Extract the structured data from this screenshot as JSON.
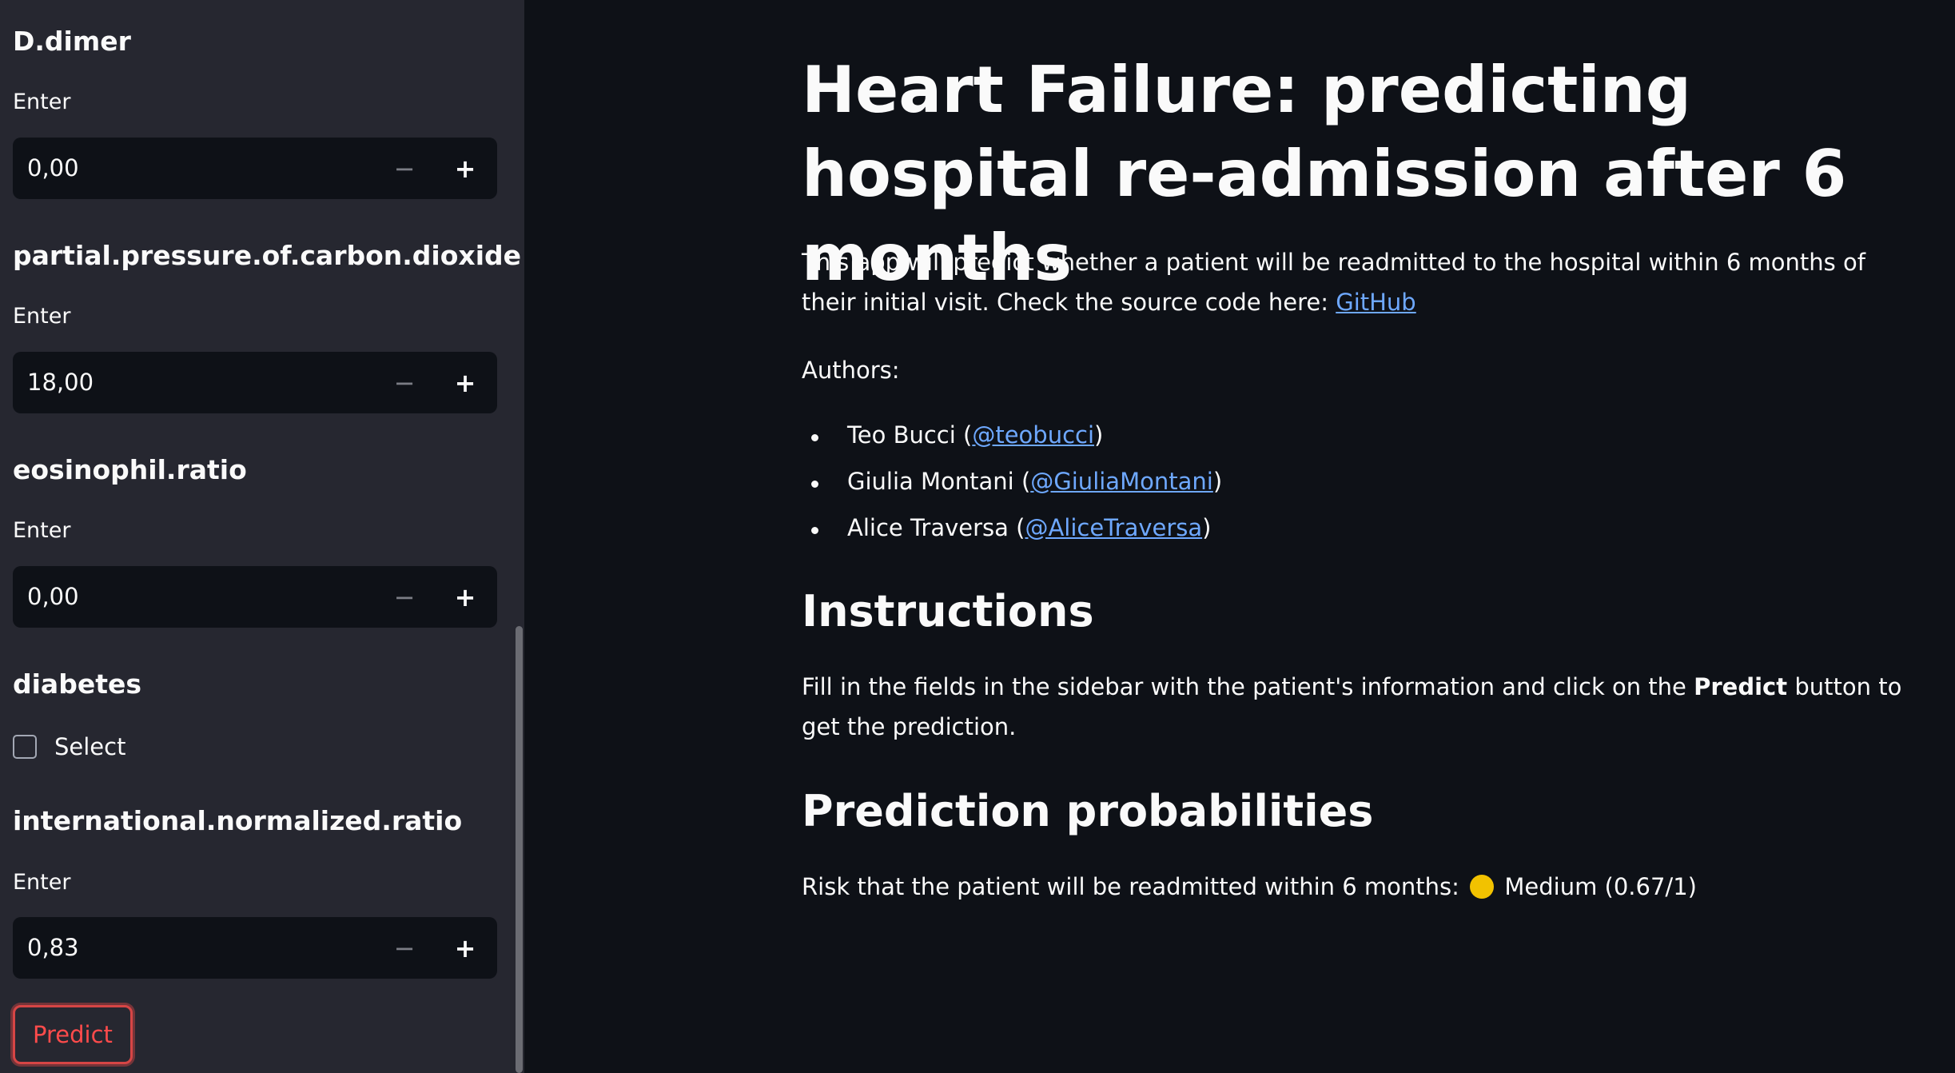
{
  "sidebar": {
    "fields": [
      {
        "title": "D.dimer",
        "label": "Enter",
        "value": "0,00"
      },
      {
        "title": "partial.pressure.of.carbon.dioxide",
        "label": "Enter",
        "value": "18,00"
      },
      {
        "title": "eosinophil.ratio",
        "label": "Enter",
        "value": "0,00"
      }
    ],
    "diabetes": {
      "title": "diabetes",
      "checkbox_label": "Select",
      "checked": false
    },
    "inr": {
      "title": "international.normalized.ratio",
      "label": "Enter",
      "value": "0,83"
    },
    "stepper_minus": "−",
    "stepper_plus": "+",
    "predict_label": "Predict"
  },
  "main": {
    "title": "Heart Failure: predicting hospital re-admission after 6 months",
    "intro_text": "This app will predict whether a patient will be readmitted to the hospital within 6 months of their initial visit. Check the source code here: ",
    "intro_link": "GitHub",
    "authors_label": "Authors:",
    "authors": [
      {
        "name": "Teo Bucci (",
        "handle": "@teobucci",
        "close": ")"
      },
      {
        "name": "Giulia Montani (",
        "handle": "@GiuliaMontani",
        "close": ")"
      },
      {
        "name": "Alice Traversa (",
        "handle": "@AliceTraversa",
        "close": ")"
      }
    ],
    "instructions_heading": "Instructions",
    "instructions_before": "Fill in the fields in the sidebar with the patient's information and click on the ",
    "instructions_bold": "Predict",
    "instructions_after": " button to get the prediction.",
    "probabilities_heading": "Prediction probabilities",
    "risk_text": "Risk that the patient will be readmitted within 6 months:",
    "risk_level": "Medium (0.67/1)",
    "risk_color": "#f2c200",
    "link_color": "#6ea8ff"
  }
}
